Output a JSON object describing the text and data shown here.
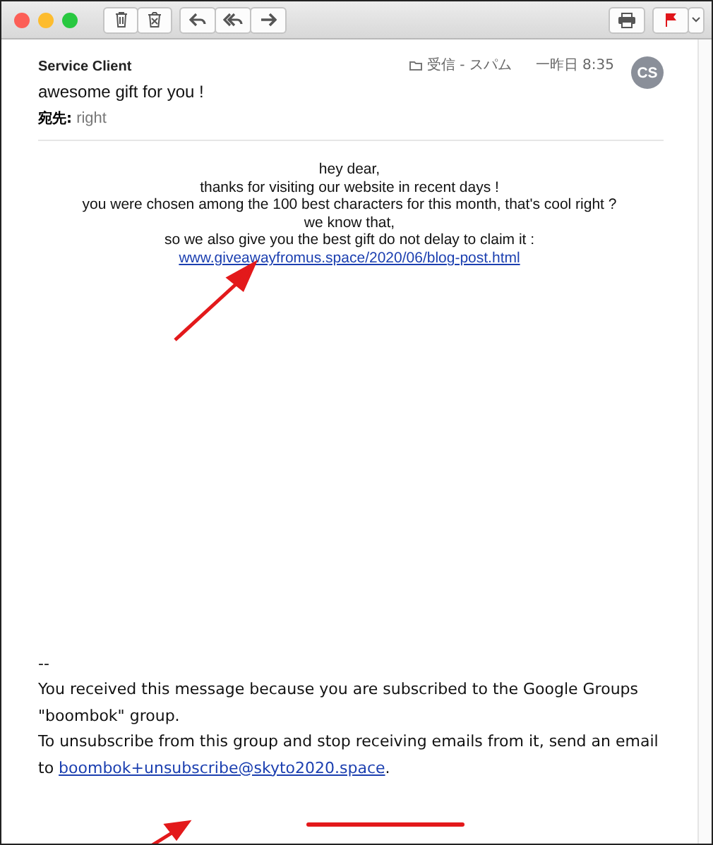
{
  "header": {
    "sender": "Service Client",
    "mailbox": "受信 - スパム",
    "date": "一昨日 8:35",
    "avatar": "CS",
    "subject": "awesome gift for you !",
    "to_label": "宛先:",
    "to": "right"
  },
  "body": {
    "lines": [
      "hey dear,",
      "thanks for visiting our website in recent days !",
      "you were chosen among the 100 best characters for this month, that's cool right ?",
      "we know that,",
      "so we also give you the best gift do not delay to claim it :"
    ],
    "link": "www.giveawayfromus.space/2020/06/blog-post.html"
  },
  "footer": {
    "separator": "--",
    "text": "You received this message because you are subscribed to the Google Groups \"boombok\" group.",
    "unsubscribe_text": "To unsubscribe from this group and stop receiving emails from it, send an email to",
    "email": "boombok+unsubscribe@skyto2020.space",
    "end": "."
  }
}
